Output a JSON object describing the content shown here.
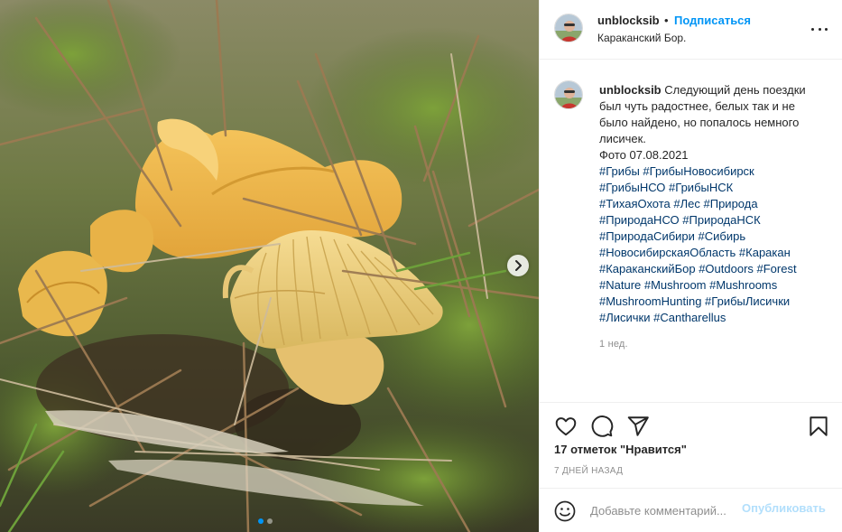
{
  "post": {
    "image_alt": "Лисички в лесной траве",
    "next_icon": "chevron-right-icon",
    "carousel_total": 2,
    "carousel_active": 1
  },
  "header": {
    "username": "unblocksib",
    "separator": "•",
    "follow_label": "Подписаться",
    "location": "Караканский Бор.",
    "more_icon": "more-options-icon"
  },
  "caption": {
    "username": "unblocksib",
    "text_lines": [
      "Следующий день поездки",
      "был чуть радостнее, белых так и не",
      "было найдено, но попалось немного",
      "лисичек.",
      "Фото 07.08.2021"
    ],
    "hashtag_lines": [
      "#Грибы #ГрибыНовосибирск",
      "#ГрибыНСО #ГрибыНСК",
      "#ТихаяОхота #Лес #Природа",
      "#ПриродаНСО #ПриродаНСК",
      "#ПриродаСибири #Сибирь",
      "#НовосибирскаяОбласть #Каракан",
      "#КараканскийБор #Outdoors #Forest",
      "#Nature #Mushroom #Mushrooms",
      "#MushroomHunting #ГрибыЛисички",
      "#Лисички #Cantharellus"
    ],
    "time": "1 нед."
  },
  "actions": {
    "like_icon": "heart-icon",
    "comment_icon": "comment-bubble-icon",
    "share_icon": "paper-plane-icon",
    "save_icon": "bookmark-icon"
  },
  "likes": "17 отметок \"Нравится\"",
  "date": "7 ДНЕЙ НАЗАД",
  "comment": {
    "emoji_icon": "smiley-icon",
    "placeholder": "Добавьте комментарий...",
    "post_label": "Опубликовать"
  },
  "colors": {
    "accent": "#0095f6",
    "hashtag": "#00376b",
    "post_disabled": "#b2dffc",
    "muted": "#8e8e8e"
  }
}
